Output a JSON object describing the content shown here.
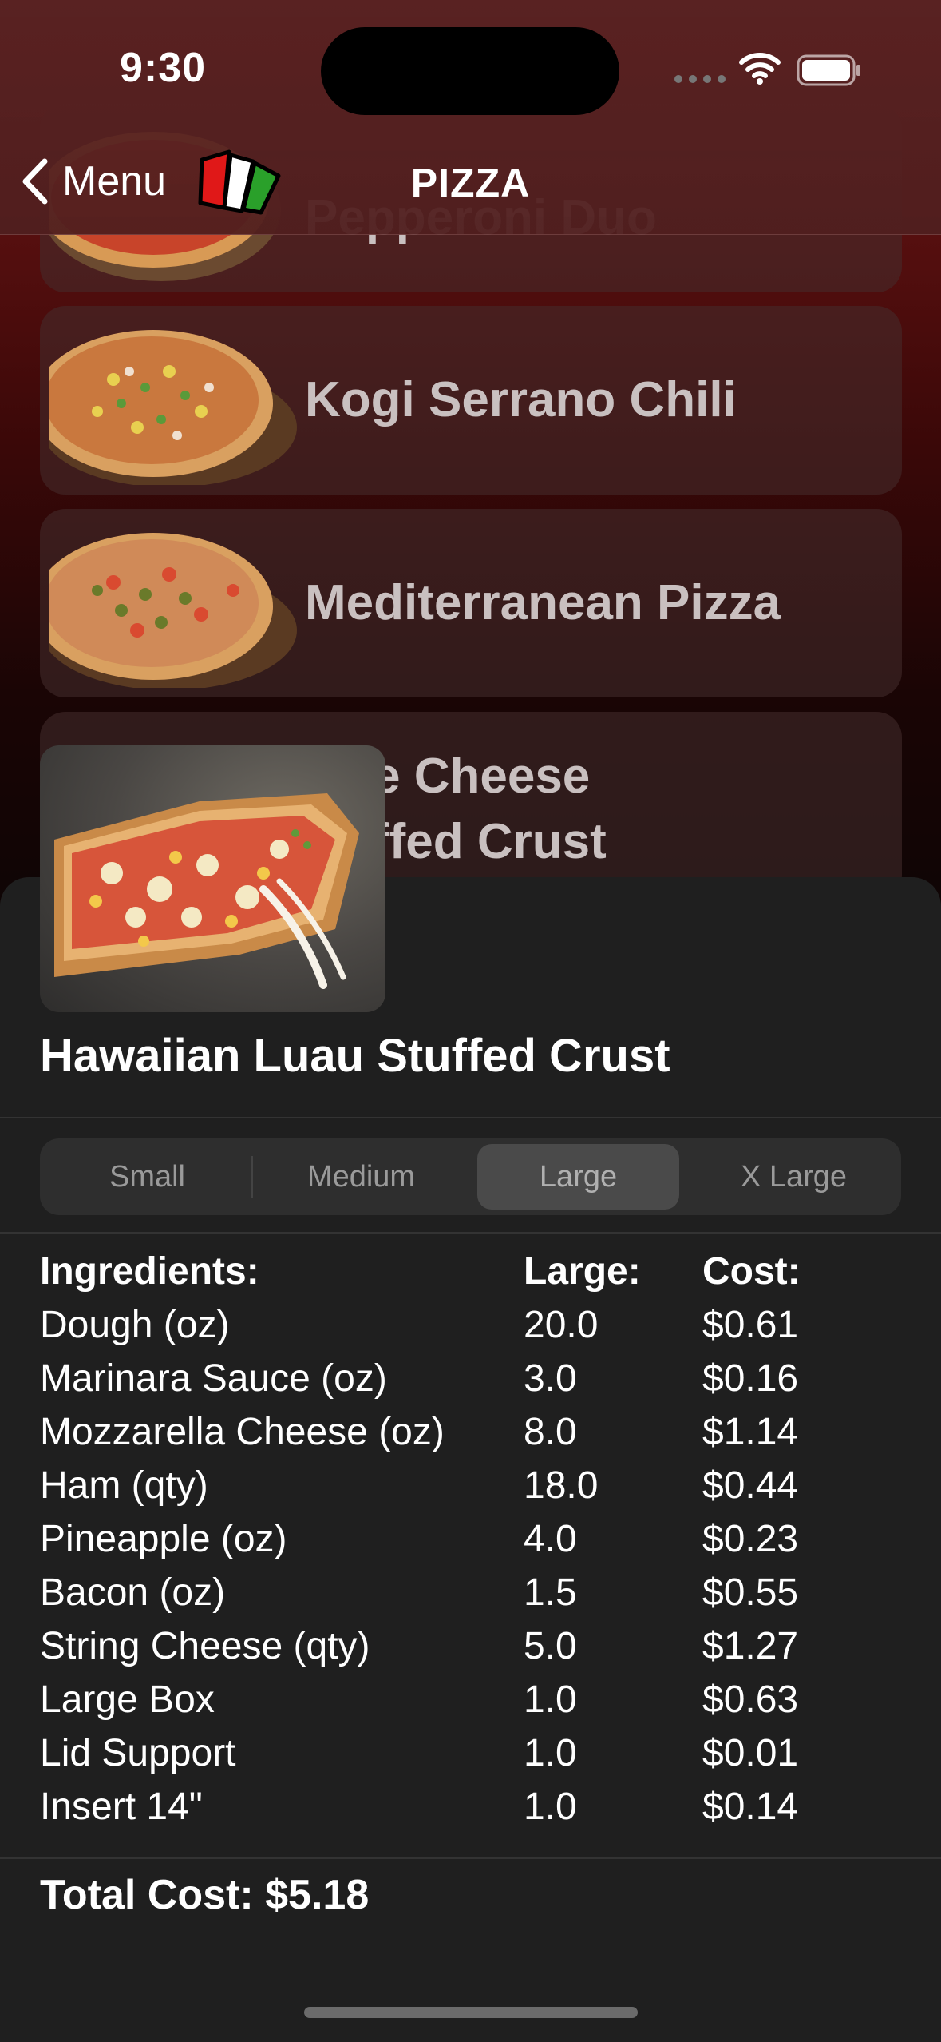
{
  "status_bar": {
    "time": "9:30"
  },
  "nav": {
    "back_label": "Menu",
    "title": "PIZZA"
  },
  "pizza_list": [
    {
      "name": "Pepperoni Duo"
    },
    {
      "name": "Kogi Serrano Chili"
    },
    {
      "name": "Mediterranean Pizza"
    },
    {
      "name_line1": "e Cheese",
      "name_line2": "ffed Crust"
    }
  ],
  "detail": {
    "title": "Hawaiian Luau Stuffed Crust",
    "sizes": [
      "Small",
      "Medium",
      "Large",
      "X Large"
    ],
    "selected_size": "Large",
    "headers": {
      "ingredient": "Ingredients:",
      "amount": "Large:",
      "cost": "Cost:"
    },
    "ingredients": [
      {
        "name": "Dough (oz)",
        "amount": "20.0",
        "cost": "$0.61"
      },
      {
        "name": "Marinara Sauce (oz)",
        "amount": "3.0",
        "cost": "$0.16"
      },
      {
        "name": "Mozzarella Cheese (oz)",
        "amount": "8.0",
        "cost": "$1.14"
      },
      {
        "name": "Ham (qty)",
        "amount": "18.0",
        "cost": "$0.44"
      },
      {
        "name": "Pineapple (oz)",
        "amount": "4.0",
        "cost": "$0.23"
      },
      {
        "name": "Bacon (oz)",
        "amount": "1.5",
        "cost": "$0.55"
      },
      {
        "name": "String Cheese (qty)",
        "amount": "5.0",
        "cost": "$1.27"
      },
      {
        "name": "Large Box",
        "amount": "1.0",
        "cost": "$0.63"
      },
      {
        "name": "Lid Support",
        "amount": "1.0",
        "cost": "$0.01"
      },
      {
        "name": "Insert 14\"",
        "amount": "1.0",
        "cost": "$0.14"
      }
    ],
    "total_cost": "Total Cost: $5.18"
  }
}
